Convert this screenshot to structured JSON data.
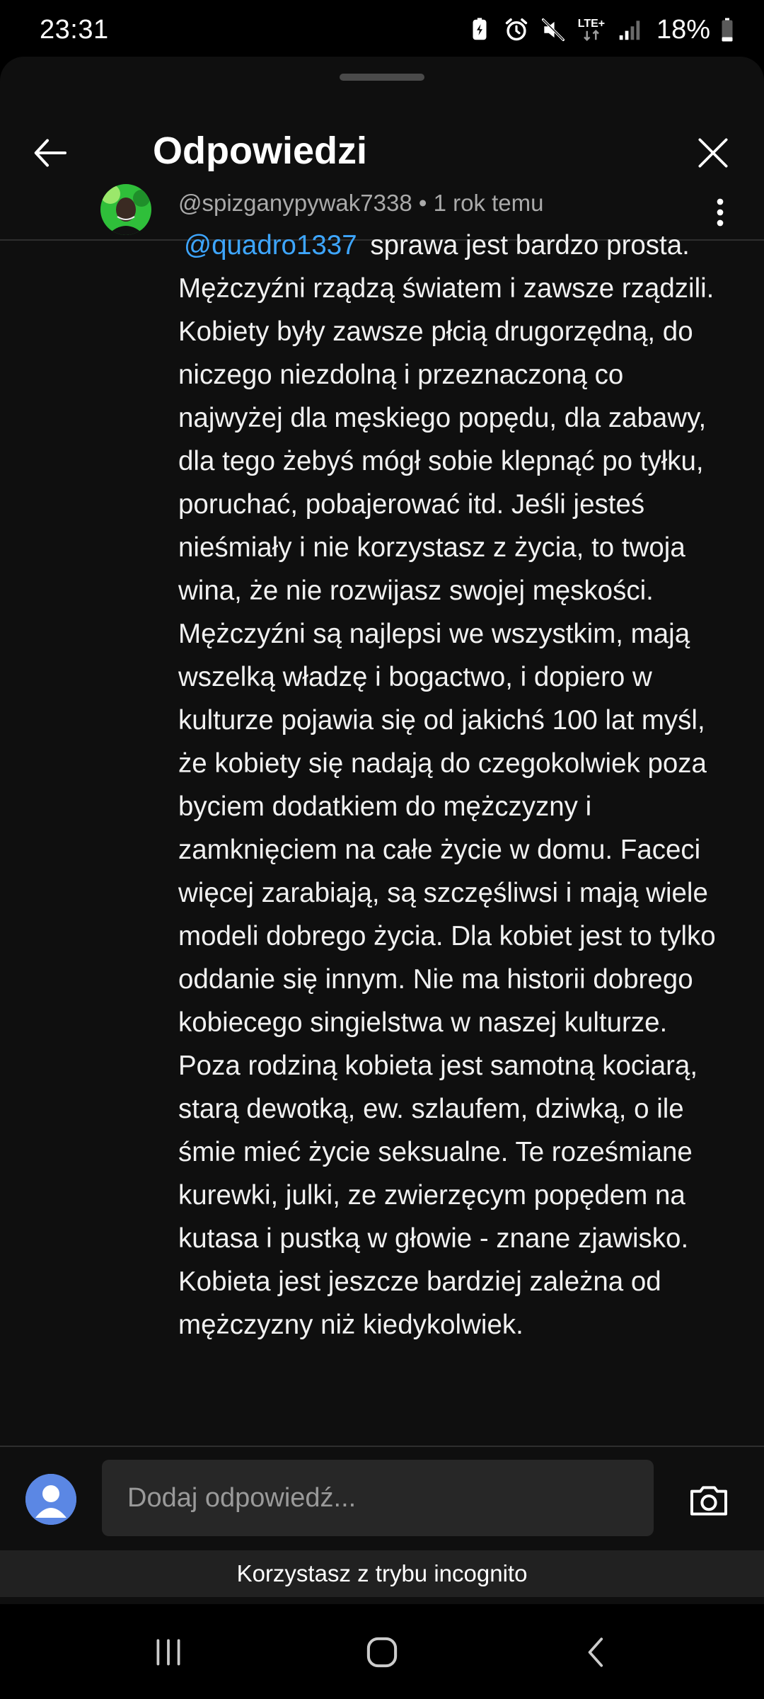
{
  "status_bar": {
    "time": "23:31",
    "network_label": "LTE+",
    "battery_percent": "18%",
    "icons": [
      "battery-saver-icon",
      "alarm-icon",
      "mute-icon",
      "lte-icon",
      "signal-icon",
      "battery-icon"
    ]
  },
  "header": {
    "title": "Odpowiedzi",
    "back_icon": "arrow-left-icon",
    "close_icon": "close-icon"
  },
  "comment": {
    "author": "@spizganypywak7338",
    "separator": "•",
    "time_ago": "1 rok temu",
    "mention": "@quadro1337",
    "text": "sprawa jest bardzo prosta. Mężczyźni rządzą światem i zawsze rządzili. Kobiety były zawsze płcią drugorzędną, do niczego niezdolną i przeznaczoną co najwyżej dla męskiego popędu, dla zabawy, dla tego żebyś mógł sobie klepnąć po tyłku, poruchać, pobajerować itd. Jeśli jesteś nieśmiały i nie korzystasz z życia, to twoja wina, że nie rozwijasz swojej męskości. Mężczyźni są najlepsi we wszystkim, mają wszelką władzę i bogactwo, i dopiero w kulturze pojawia się od jakichś 100 lat myśl, że kobiety się nadają do czegokolwiek poza byciem dodatkiem do mężczyzny i zamknięciem na całe życie w domu. Faceci więcej zarabiają, są szczęśliwsi i mają wiele modeli dobrego życia. Dla kobiet jest to tylko oddanie się innym. Nie ma historii dobrego kobiecego singielstwa w naszej kulturze. Poza rodziną kobieta jest samotną kociarą, starą dewotką, ew. szlaufem, dziwką, o ile śmie mieć życie seksualne. Te roześmiane kurewki, julki, ze zwierzęcym popędem na kutasa i pustką w głowie - znane zjawisko. Kobieta jest jeszcze bardziej zależna od mężczyzny niż kiedykolwiek."
  },
  "reply": {
    "placeholder": "Dodaj odpowiedź...",
    "camera_icon": "camera-icon"
  },
  "incognito_notice": "Korzystasz z trybu incognito",
  "colors": {
    "background": "#0f0f0f",
    "mention": "#3ea6ff",
    "meta_text": "#aaaaaa",
    "avatar_accent": "#2fbf3a",
    "reply_avatar": "#5b87e4"
  }
}
